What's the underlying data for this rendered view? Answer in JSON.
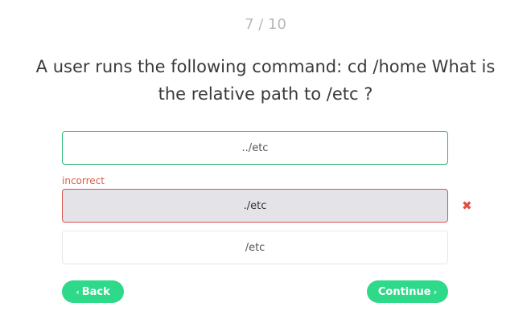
{
  "progress": "7 / 10",
  "question": "A user runs the following command: cd /home What is the relative path to /etc ?",
  "options": [
    {
      "label": "../etc",
      "state": "correct"
    },
    {
      "label": "./etc",
      "state": "incorrect"
    },
    {
      "label": "/etc",
      "state": "neutral"
    }
  ],
  "feedback": {
    "incorrect_label": "incorrect",
    "wrong_mark": "✖"
  },
  "nav": {
    "back_chevron": "‹",
    "back_label": "Back",
    "continue_label": "Continue",
    "continue_chevron": "›"
  },
  "colors": {
    "accent_green": "#2fd98a",
    "correct_border": "#2bb673",
    "incorrect_red": "#d9534f",
    "selected_bg": "#e3e3e8"
  }
}
